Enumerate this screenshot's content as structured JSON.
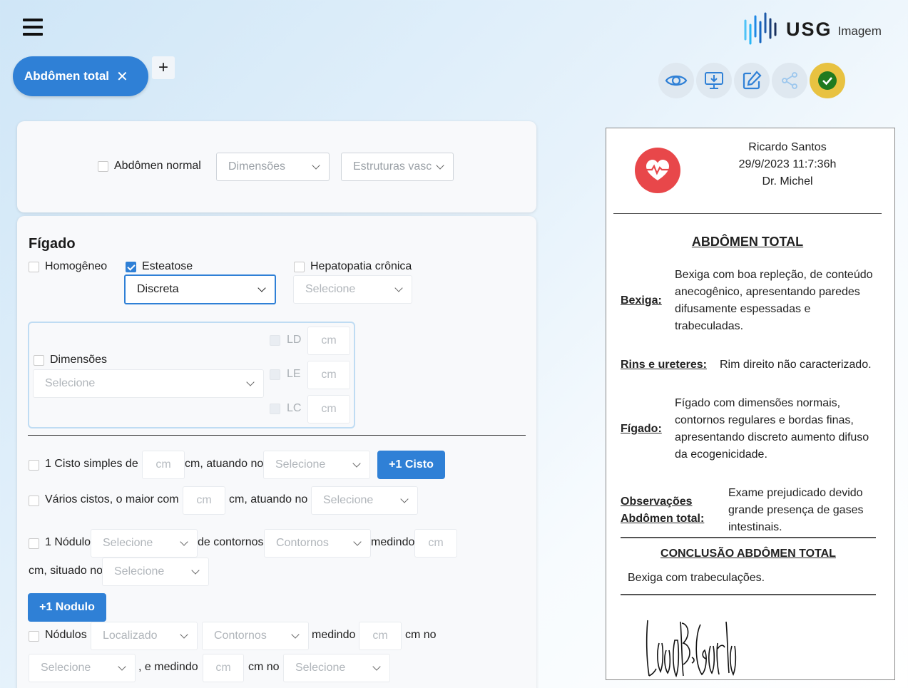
{
  "header": {
    "logo_word": "USG",
    "logo_sub": "Imagem",
    "tab_label": "Abdômen total",
    "tab_close": "✕",
    "add_tab": "+"
  },
  "toolbar": {
    "icons": [
      "eye-icon",
      "download-icon",
      "edit-icon",
      "share-icon",
      "check-icon"
    ]
  },
  "top_card": {
    "normal_label": "Abdômen normal",
    "dimensoes_placeholder": "Dimensões",
    "estruturas_placeholder": "Estruturas vasc"
  },
  "figado": {
    "title": "Fígado",
    "homogeneo": "Homogêneo",
    "esteatose": "Esteatose",
    "esteatose_value": "Discreta",
    "hepatopatia": "Hepatopatia crônica",
    "hepatopatia_placeholder": "Selecione",
    "dimensoes_label": "Dimensões",
    "dimensoes_placeholder": "Selecione",
    "ld": "LD",
    "le": "LE",
    "lc": "LC",
    "cm": "cm",
    "cisto_label": "1 Cisto simples de",
    "cisto_mid": "cm, atuando no",
    "cisto_placeholder": "Selecione",
    "cisto_button": "+1 Cisto",
    "varios_label": "Vários cistos, o maior com",
    "varios_mid": "cm, atuando no",
    "varios_placeholder": "Selecione",
    "nodulo_label": "1 Nódulo",
    "nodulo_placeholder": "Selecione",
    "contornos_label": "de contornos",
    "contornos_placeholder": "Contornos",
    "medindo": "medindo",
    "situado": "cm, situado no",
    "situado_placeholder": "Selecione",
    "nodulo_button": "+1 Nodulo",
    "nodulos_label": "Nódulos",
    "localizado_placeholder": "Localizado",
    "cm_no": "cm no",
    "e_medindo": ", e medindo",
    "selecione": "Selecione"
  },
  "report": {
    "patient": "Ricardo Santos",
    "datetime": "29/9/2023 11:7:36h",
    "doctor": "Dr. Michel",
    "title": "ABDÔMEN TOTAL",
    "items": [
      {
        "label": "Bexiga:",
        "text": "Bexiga com boa repleção, de conteúdo anecogênico, apresentando paredes difusamente espessadas e trabeculadas."
      },
      {
        "label": "Rins e ureteres:",
        "text": "Rim direito não caracterizado."
      },
      {
        "label": "Fígado:",
        "text": "Fígado com dimensões normais, contornos regulares e bordas finas, apresentando discreto aumento difuso da ecogenicidade."
      },
      {
        "label": "Observações Abdômen total:",
        "text": "Exame prejudicado devido grande presença de gases intestinais."
      }
    ],
    "conclusion_title": "CONCLUSÃO ABDÔMEN TOTAL",
    "conclusion_text": "Bexiga com trabeculações.",
    "signature": "Lucas B. Garcia"
  },
  "colors": {
    "primary": "#2f80d6",
    "heart_badge": "#e8474a",
    "confirm": "#e8c241",
    "confirm_check": "#1f7a1f"
  }
}
